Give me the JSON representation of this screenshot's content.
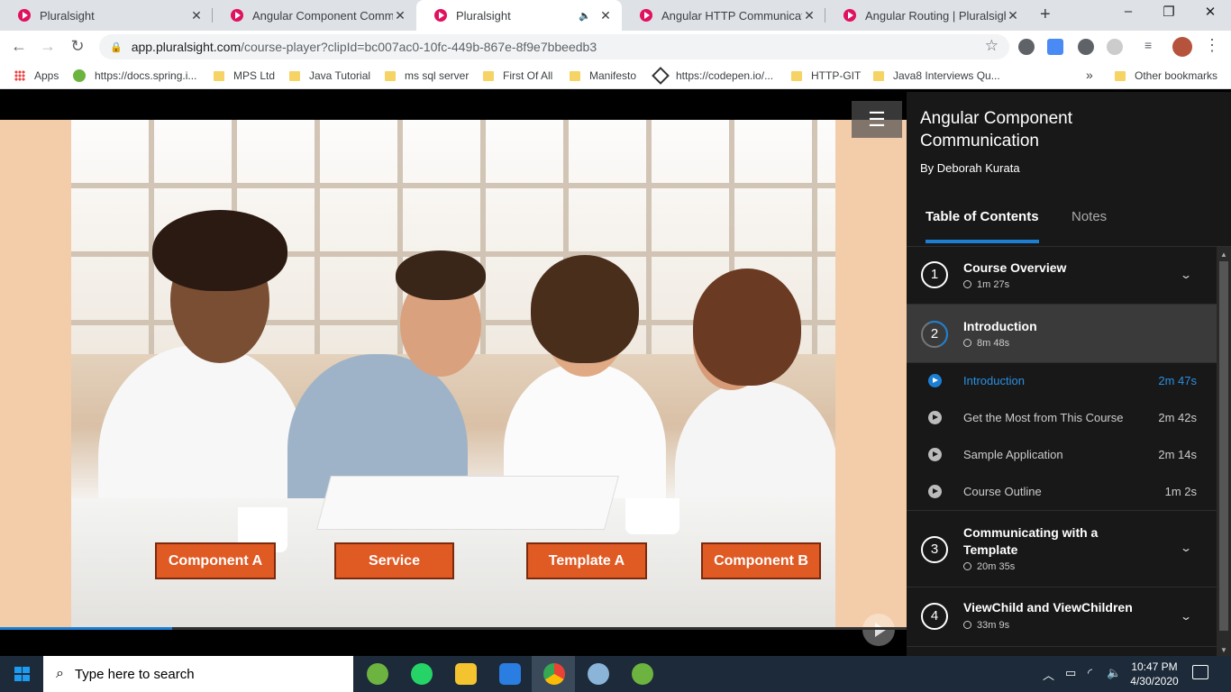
{
  "browser": {
    "tabs": [
      {
        "title": "Pluralsight",
        "active": false
      },
      {
        "title": "Angular Component Communi",
        "active": false
      },
      {
        "title": "Pluralsight",
        "active": true,
        "audio": true
      },
      {
        "title": "Angular HTTP Communication",
        "active": false
      },
      {
        "title": "Angular Routing | Pluralsight",
        "active": false
      }
    ],
    "close_glyph": "✕",
    "new_tab_glyph": "+",
    "window_controls": [
      "–",
      "❐",
      "✕"
    ],
    "url_host": "app.pluralsight.com",
    "url_path": "/course-player?clipId=bc007ac0-10fc-449b-867e-8f9e7bbeedb3",
    "bookmarks": [
      {
        "label": "Apps",
        "icon": "apps-grid-icon"
      },
      {
        "label": "https://docs.spring.i...",
        "icon": "spring-icon"
      },
      {
        "label": "MPS Ltd",
        "icon": "folder-icon"
      },
      {
        "label": "Java Tutorial",
        "icon": "folder-icon"
      },
      {
        "label": "ms sql server",
        "icon": "folder-icon"
      },
      {
        "label": "First Of All",
        "icon": "folder-icon"
      },
      {
        "label": "Manifesto",
        "icon": "folder-icon"
      },
      {
        "label": "https://codepen.io/...",
        "icon": "codepen-icon"
      },
      {
        "label": "HTTP-GIT",
        "icon": "folder-icon"
      },
      {
        "label": "Java8 Interviews Qu...",
        "icon": "folder-icon"
      }
    ],
    "bookmarks_overflow": "»",
    "other_bookmarks": "Other bookmarks"
  },
  "player": {
    "slide_labels": [
      "Component A",
      "Service",
      "Template A",
      "Component B"
    ],
    "progress_fraction": 0.19,
    "colors": {
      "accent": "#1d7fd3",
      "label_bg": "#e05a24"
    }
  },
  "sidebar": {
    "course_title": "Angular Component Communication",
    "author": "By Deborah Kurata",
    "tabs": [
      "Table of Contents",
      "Notes"
    ],
    "modules": [
      {
        "number": "1",
        "title": "Course Overview",
        "duration": "1m 27s",
        "expanded": false
      },
      {
        "number": "2",
        "title": "Introduction",
        "duration": "8m 48s",
        "expanded": true
      },
      {
        "number": "3",
        "title": "Communicating with a Template",
        "duration": "20m 35s",
        "expanded": false
      },
      {
        "number": "4",
        "title": "ViewChild and ViewChildren",
        "duration": "33m 9s",
        "expanded": false
      }
    ],
    "clips": [
      {
        "title": "Introduction",
        "duration": "2m 47s",
        "active": true
      },
      {
        "title": "Get the Most from This Course",
        "duration": "2m 42s",
        "active": false
      },
      {
        "title": "Sample Application",
        "duration": "2m 14s",
        "active": false
      },
      {
        "title": "Course Outline",
        "duration": "1m 2s",
        "active": false
      }
    ]
  },
  "taskbar": {
    "search_placeholder": "Type here to search",
    "time": "10:47 PM",
    "date": "4/30/2020",
    "apps": [
      "spring-tools-icon",
      "whatsapp-icon",
      "file-explorer-icon",
      "photos-icon",
      "chrome-icon",
      "paint-icon",
      "spring-tools-icon"
    ]
  }
}
